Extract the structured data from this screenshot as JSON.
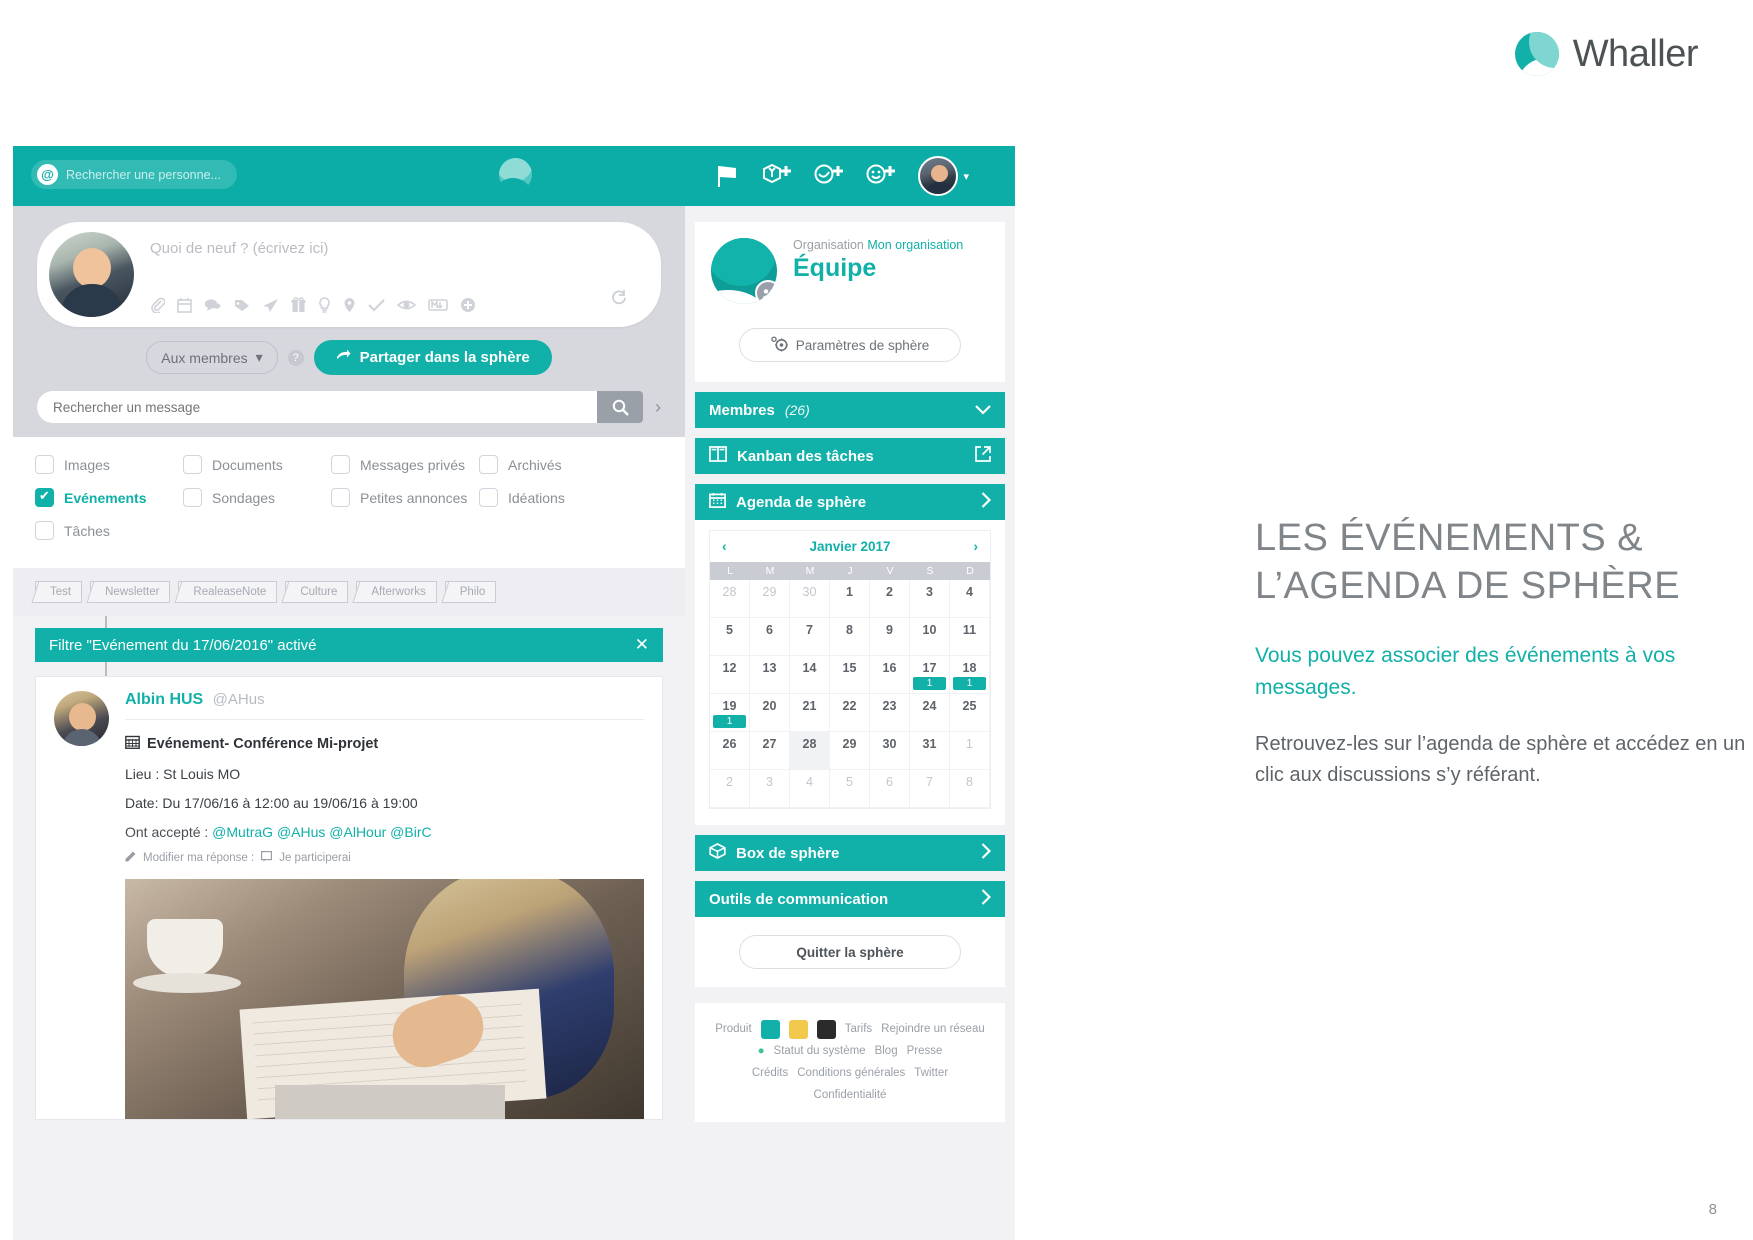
{
  "brand": {
    "name": "Whaller"
  },
  "topbar": {
    "search_placeholder": "Rechercher une personne...",
    "icons": [
      "flag-icon",
      "add-sphere-icon",
      "add-circle-icon",
      "add-contact-icon"
    ],
    "avatar": "user-avatar"
  },
  "compose": {
    "placeholder": "Quoi de neuf ? (écrivez ici)",
    "audience_label": "Aux membres",
    "share_label": "Partager dans la sphère",
    "toolbar_icons": [
      "paperclip-icon",
      "calendar-icon",
      "comment-icon",
      "tag-icon",
      "send-icon",
      "gift-icon",
      "lightbulb-icon",
      "location-pin-icon",
      "check-icon",
      "eye-icon",
      "markdown-icon",
      "plus-circle-icon"
    ],
    "refresh_icon": "refresh-icon"
  },
  "message_search": {
    "placeholder": "Rechercher un message",
    "search_icon": "search-icon",
    "expand_icon": "chevron-right-icon"
  },
  "filters": [
    {
      "label": "Images",
      "checked": false
    },
    {
      "label": "Documents",
      "checked": false
    },
    {
      "label": "Messages privés",
      "checked": false
    },
    {
      "label": "Archivés",
      "checked": false
    },
    {
      "label": "Evénements",
      "checked": true
    },
    {
      "label": "Sondages",
      "checked": false
    },
    {
      "label": "Petites annonces",
      "checked": false
    },
    {
      "label": "Idéations",
      "checked": false
    },
    {
      "label": "Tâches",
      "checked": false
    }
  ],
  "tags": [
    "Test",
    "Newsletter",
    "RealeaseNote",
    "Culture",
    "Afterworks",
    "Philo"
  ],
  "filter_banner": {
    "text": "Filtre \"Evénement du 17/06/2016\" activé",
    "close_label": "✕"
  },
  "post": {
    "author_name": "Albin HUS",
    "author_handle": "@AHus",
    "event_title": "Evénement- Conférence Mi-projet",
    "location_line": "Lieu : St Louis MO",
    "date_line": "Date: Du 17/06/16 à 12:00 au 19/06/16 à 19:00",
    "accepted_label": "Ont accepté : ",
    "accepted_mentions": "@MutraG @AHus @AlHour @BirC",
    "modify_label": "Modifier ma réponse :",
    "participate_label": "Je participerai"
  },
  "sphere": {
    "organisation_label": "Organisation",
    "organisation_name": "Mon organisation",
    "title": "Équipe",
    "settings_label": "Paramètres de sphère",
    "menu": [
      {
        "label": "Membres",
        "count": "(26)",
        "icon": null,
        "chevron": "chevron-down-icon"
      },
      {
        "label": "Kanban des tâches",
        "icon": "kanban-icon",
        "chevron": "external-link-icon"
      },
      {
        "label": "Agenda de sphère",
        "icon": "calendar-icon",
        "chevron": "chevron-right-icon"
      }
    ],
    "menu_bottom": [
      {
        "label": "Box de sphère",
        "icon": "box-icon",
        "chevron": "chevron-right-icon"
      },
      {
        "label": "Outils de communication",
        "icon": null,
        "chevron": "chevron-right-icon"
      }
    ],
    "quit_label": "Quitter la sphère"
  },
  "calendar": {
    "month_label": "Janvier 2017",
    "prev_icon": "chevron-left-icon",
    "next_icon": "chevron-right-icon",
    "dow": [
      "L",
      "M",
      "M",
      "J",
      "V",
      "S",
      "D"
    ],
    "weeks": [
      [
        {
          "d": "28",
          "mut": true
        },
        {
          "d": "29",
          "mut": true
        },
        {
          "d": "30",
          "mut": true
        },
        {
          "d": "1"
        },
        {
          "d": "2"
        },
        {
          "d": "3"
        },
        {
          "d": "4"
        }
      ],
      [
        {
          "d": "5"
        },
        {
          "d": "6"
        },
        {
          "d": "7"
        },
        {
          "d": "8"
        },
        {
          "d": "9"
        },
        {
          "d": "10"
        },
        {
          "d": "11"
        }
      ],
      [
        {
          "d": "12"
        },
        {
          "d": "13"
        },
        {
          "d": "14"
        },
        {
          "d": "15"
        },
        {
          "d": "16"
        },
        {
          "d": "17",
          "ev": "1"
        },
        {
          "d": "18",
          "ev": "1"
        }
      ],
      [
        {
          "d": "19",
          "ev": "1"
        },
        {
          "d": "20"
        },
        {
          "d": "21"
        },
        {
          "d": "22"
        },
        {
          "d": "23"
        },
        {
          "d": "24"
        },
        {
          "d": "25"
        }
      ],
      [
        {
          "d": "26"
        },
        {
          "d": "27"
        },
        {
          "d": "28",
          "today": true
        },
        {
          "d": "29"
        },
        {
          "d": "30"
        },
        {
          "d": "31"
        },
        {
          "d": "1",
          "mut": true
        }
      ],
      [
        {
          "d": "2",
          "mut": true
        },
        {
          "d": "3",
          "mut": true
        },
        {
          "d": "4",
          "mut": true
        },
        {
          "d": "5",
          "mut": true
        },
        {
          "d": "6",
          "mut": true
        },
        {
          "d": "7",
          "mut": true
        },
        {
          "d": "8",
          "mut": true
        }
      ]
    ]
  },
  "footer": {
    "produit": "Produit",
    "tarifs": "Tarifs",
    "rejoindre": "Rejoindre un réseau",
    "statut": "Statut du système",
    "blog": "Blog",
    "presse": "Presse",
    "credits": "Crédits",
    "conditions": "Conditions générales",
    "twitter": "Twitter",
    "confidentialite": "Confidentialité"
  },
  "copy": {
    "heading": "LES ÉVÉNEMENTS & L’AGENDA DE SPHÈRE",
    "lead": "Vous pouvez associer des événements à vos messages.",
    "body": "Retrouvez-les sur l’agenda de sphère et accédez en un clic aux discussions s’y référant."
  },
  "page_number": "8",
  "colors": {
    "teal": "#11b0a8",
    "teal_dark": "#0bada6",
    "grey_text": "#8b9097"
  }
}
